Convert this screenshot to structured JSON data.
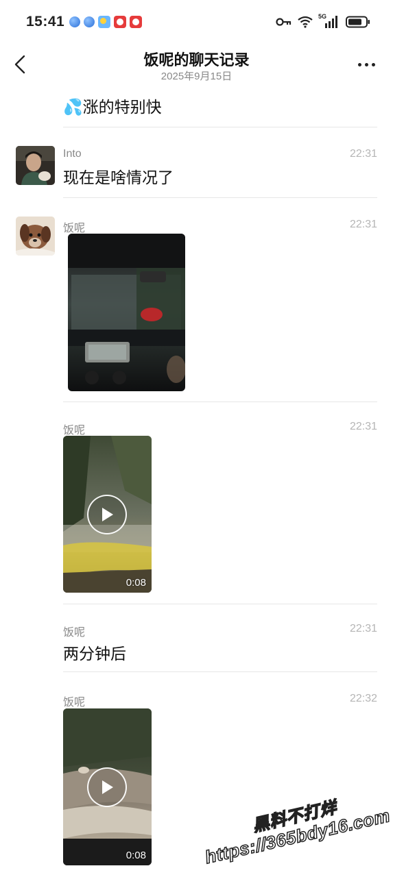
{
  "status_bar": {
    "time": "15:41",
    "notification_icons": [
      "browser-icon",
      "browser-icon",
      "weather-icon",
      "app-red-icon",
      "app-red-icon"
    ],
    "system_icons": [
      "key-icon",
      "wifi-icon",
      "signal-5g-icon",
      "battery-icon"
    ],
    "network_label": "5G"
  },
  "header": {
    "title": "饭呢的聊天记录",
    "subtitle": "2025年9月15日",
    "back_icon": "chevron-left-icon",
    "more_icon": "more-dots-icon"
  },
  "messages": [
    {
      "sender": "",
      "time": "",
      "text": "💦涨的特别快",
      "type": "text",
      "avatar": "none"
    },
    {
      "sender": "Into",
      "time": "22:31",
      "text": "现在是啥情况了",
      "type": "text",
      "avatar": "avatar-man"
    },
    {
      "sender": "饭呢",
      "time": "22:31",
      "type": "image",
      "avatar": "avatar-dog",
      "media_desc": "photo"
    },
    {
      "sender": "饭呢",
      "time": "22:31",
      "type": "video",
      "duration": "0:08"
    },
    {
      "sender": "饭呢",
      "time": "22:31",
      "text": "两分钟后",
      "type": "text"
    },
    {
      "sender": "饭呢",
      "time": "22:32",
      "type": "video",
      "duration": "0:08"
    }
  ],
  "watermark": {
    "line1": "黑料不打烊",
    "line2": "https://365bdy16.com"
  },
  "colors": {
    "background": "#ffffff",
    "text_primary": "#111111",
    "text_secondary": "#888888",
    "time_text": "#b5b5b5",
    "divider": "#e6e6e6"
  }
}
